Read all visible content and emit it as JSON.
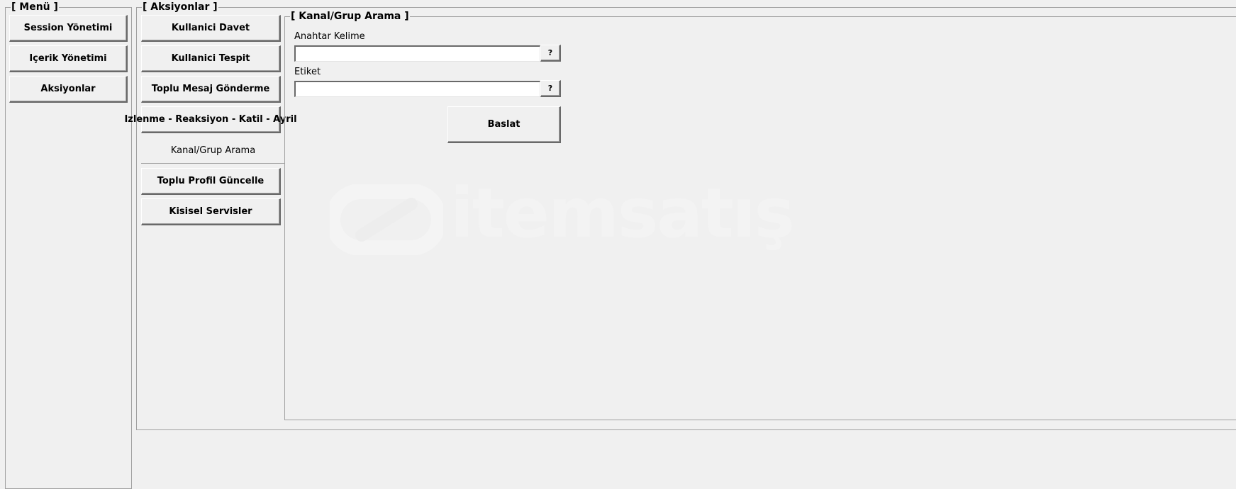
{
  "menu": {
    "title": "[ Menü ]",
    "items": [
      {
        "label": "Session Yönetimi"
      },
      {
        "label": "Içerik Yönetimi"
      },
      {
        "label": "Aksiyonlar"
      }
    ]
  },
  "actions": {
    "title": "[ Aksiyonlar ]",
    "items": [
      {
        "label": "Kullanici Davet"
      },
      {
        "label": "Kullanici Tespit"
      },
      {
        "label": "Toplu Mesaj Gönderme"
      },
      {
        "label": "Izlenme - Reaksiyon - Katil - Ayril"
      },
      {
        "label": "Kanal/Grup Arama",
        "active": true
      },
      {
        "label": "Toplu Profil Güncelle"
      },
      {
        "label": "Kisisel Servisler"
      }
    ]
  },
  "search_panel": {
    "title": "[ Kanal/Grup Arama ]",
    "keyword": {
      "label": "Anahtar Kelime",
      "value": "",
      "help_label": "?"
    },
    "tag": {
      "label": "Etiket",
      "value": "",
      "help_label": "?"
    },
    "start_label": "Baslat"
  },
  "watermark": {
    "text": "itemsatış"
  },
  "colors": {
    "background": "#f0f0f0",
    "border": "#a0a0a0",
    "button_shadow": "#696969",
    "input_bg": "#ffffff"
  }
}
